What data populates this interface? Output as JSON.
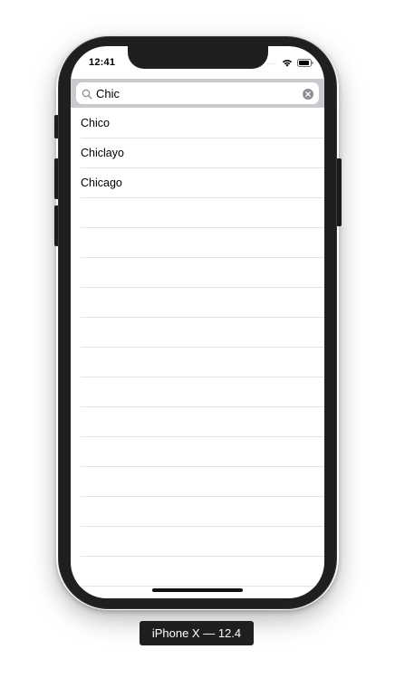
{
  "status_bar": {
    "time": "12:41",
    "signal_dots": "....",
    "icons": [
      "wifi-icon",
      "battery-icon"
    ]
  },
  "search": {
    "value": "Chic",
    "placeholder": "",
    "icons": [
      "search-icon",
      "clear-icon"
    ]
  },
  "results": [
    {
      "label": "Chico"
    },
    {
      "label": "Chiclayo"
    },
    {
      "label": "Chicago"
    },
    {
      "label": ""
    },
    {
      "label": ""
    },
    {
      "label": ""
    },
    {
      "label": ""
    },
    {
      "label": ""
    },
    {
      "label": ""
    },
    {
      "label": ""
    },
    {
      "label": ""
    },
    {
      "label": ""
    },
    {
      "label": ""
    },
    {
      "label": ""
    },
    {
      "label": ""
    },
    {
      "label": ""
    },
    {
      "label": ""
    }
  ],
  "simulator": {
    "label": "iPhone X — 12.4"
  },
  "colors": {
    "search_bar_bg": "#c9c9ce",
    "separator": "#e3e3e6",
    "device_frame": "#1f1f1f"
  }
}
